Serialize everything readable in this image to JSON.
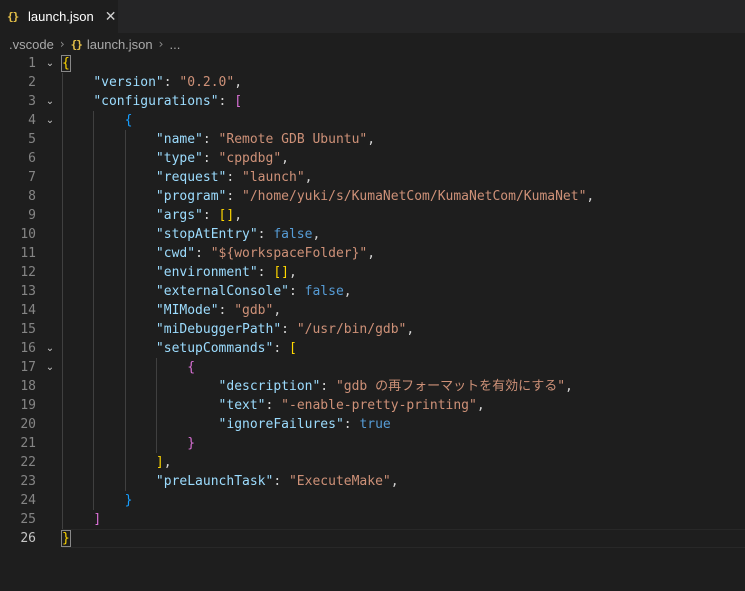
{
  "tab": {
    "icon": "braces-icon",
    "icon_glyph": "{}",
    "label": "launch.json",
    "close_glyph": "✕"
  },
  "breadcrumb": {
    "root": ".vscode",
    "file_icon_glyph": "{}",
    "file": "launch.json",
    "more": "...",
    "separator": "›"
  },
  "editor": {
    "lines": [
      {
        "n": "1",
        "text": "{"
      },
      {
        "n": "2",
        "text": "    \"version\": \"0.2.0\","
      },
      {
        "n": "3",
        "text": "    \"configurations\": ["
      },
      {
        "n": "4",
        "text": "        {"
      },
      {
        "n": "5",
        "text": "            \"name\": \"Remote GDB Ubuntu\","
      },
      {
        "n": "6",
        "text": "            \"type\": \"cppdbg\","
      },
      {
        "n": "7",
        "text": "            \"request\": \"launch\","
      },
      {
        "n": "8",
        "text": "            \"program\": \"/home/yuki/s/KumaNetCom/KumaNetCom/KumaNet\","
      },
      {
        "n": "9",
        "text": "            \"args\": [],"
      },
      {
        "n": "10",
        "text": "            \"stopAtEntry\": false,"
      },
      {
        "n": "11",
        "text": "            \"cwd\": \"${workspaceFolder}\","
      },
      {
        "n": "12",
        "text": "            \"environment\": [],"
      },
      {
        "n": "13",
        "text": "            \"externalConsole\": false,"
      },
      {
        "n": "14",
        "text": "            \"MIMode\": \"gdb\","
      },
      {
        "n": "15",
        "text": "            \"miDebuggerPath\": \"/usr/bin/gdb\","
      },
      {
        "n": "16",
        "text": "            \"setupCommands\": ["
      },
      {
        "n": "17",
        "text": "                {"
      },
      {
        "n": "18",
        "text": "                    \"description\": \"gdb の再フォーマットを有効にする\","
      },
      {
        "n": "19",
        "text": "                    \"text\": \"-enable-pretty-printing\","
      },
      {
        "n": "20",
        "text": "                    \"ignoreFailures\": true"
      },
      {
        "n": "21",
        "text": "                }"
      },
      {
        "n": "22",
        "text": "            ],"
      },
      {
        "n": "23",
        "text": "            \"preLaunchTask\": \"ExecuteMake\","
      },
      {
        "n": "24",
        "text": "        }"
      },
      {
        "n": "25",
        "text": "    ]"
      },
      {
        "n": "26",
        "text": "}"
      }
    ],
    "folds": [
      "1",
      "3",
      "4",
      "16",
      "17"
    ],
    "active_line": "26",
    "fold_glyph": "⌄"
  },
  "colors": {
    "background": "#1e1e1e",
    "tabbar": "#252526",
    "key": "#9cdcfe",
    "string": "#ce9178",
    "boolean": "#569cd6",
    "bracket_level1": "#ffd700",
    "bracket_level2": "#da70d6",
    "bracket_level3": "#179fff"
  }
}
